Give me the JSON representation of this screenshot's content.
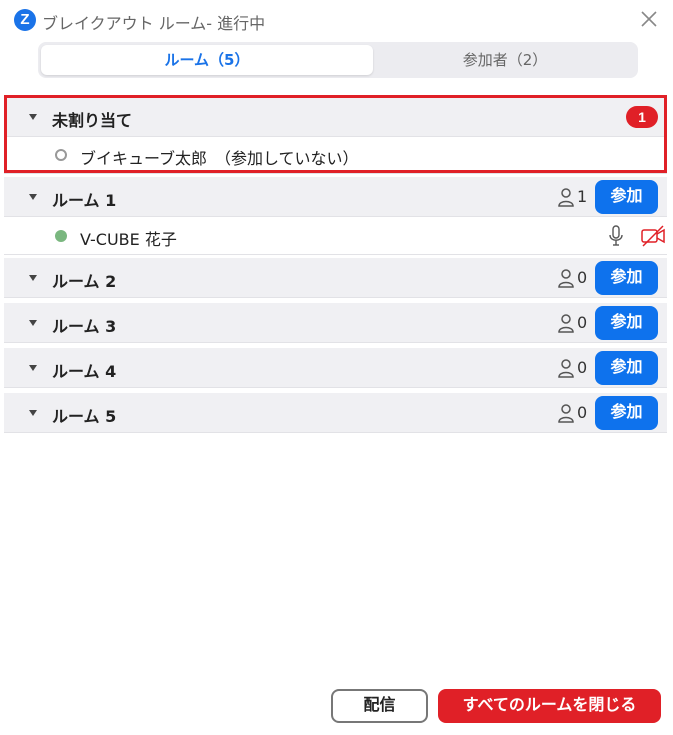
{
  "window": {
    "title": "ブレイクアウト ルーム- 進行中",
    "logo_letter": "Z"
  },
  "tabs": [
    {
      "label": "ルーム（5）",
      "active": true
    },
    {
      "label": "参加者（2）",
      "active": false
    }
  ],
  "unassigned": {
    "label": "未割り当て",
    "badge": "1",
    "members": [
      {
        "name": "ブイキューブ太郎　（参加していない）",
        "status": "not-joined"
      }
    ]
  },
  "rooms": [
    {
      "name": "ルーム 1",
      "count": "1",
      "join_label": "参加",
      "members": [
        {
          "name": "V-CUBE 花子",
          "status": "joined",
          "mic": "mic-icon",
          "camera": "video-off-icon"
        }
      ]
    },
    {
      "name": "ルーム 2",
      "count": "0",
      "join_label": "参加",
      "members": []
    },
    {
      "name": "ルーム 3",
      "count": "0",
      "join_label": "参加",
      "members": []
    },
    {
      "name": "ルーム 4",
      "count": "0",
      "join_label": "参加",
      "members": []
    },
    {
      "name": "ルーム 5",
      "count": "0",
      "join_label": "参加",
      "members": []
    }
  ],
  "footer": {
    "broadcast_label": "配信",
    "close_all_label": "すべてのルームを閉じる"
  },
  "colors": {
    "accent_blue": "#0e72ed",
    "danger_red": "#e02027",
    "joined_green": "#7ab77f"
  }
}
